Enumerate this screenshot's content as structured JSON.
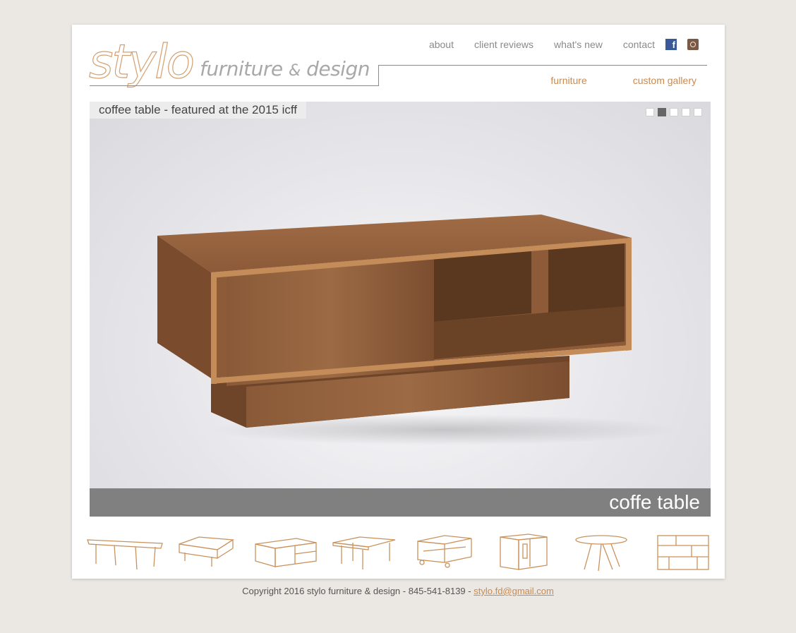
{
  "brand": {
    "name": "stylo",
    "subtitle": "furniture",
    "amp": "&",
    "subtitle2": "design"
  },
  "nav": {
    "about": "about",
    "reviews": "client reviews",
    "new": "what's new",
    "contact": "contact"
  },
  "social": {
    "facebook_icon": "facebook-icon",
    "instagram_icon": "instagram-icon"
  },
  "subnav": {
    "furniture": "furniture",
    "gallery": "custom gallery"
  },
  "hero": {
    "tag": "coffee table - featured at the 2015 icff",
    "caption": "coffe table",
    "active_slide": 2,
    "slide_count": 5
  },
  "thumbnails": [
    "dining-table-thumb",
    "coffee-table-thumb",
    "media-cabinet-thumb",
    "console-table-thumb",
    "rolling-cart-thumb",
    "cabinet-thumb",
    "round-table-thumb",
    "bookshelf-thumb"
  ],
  "footer": {
    "text": "Copyright 2016 stylo furniture & design - 845-541-8139 - ",
    "email": "stylo.fd@gmail.com"
  },
  "colors": {
    "accent": "#c98a4e",
    "nav": "#8a8a8a",
    "caption_bar": "#808080"
  }
}
